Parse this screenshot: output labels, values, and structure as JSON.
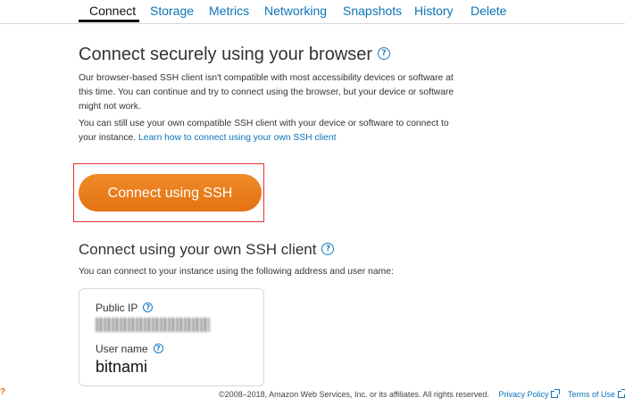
{
  "tabs": [
    {
      "label": "Connect",
      "active": true
    },
    {
      "label": "Storage"
    },
    {
      "label": "Metrics"
    },
    {
      "label": "Networking"
    },
    {
      "label": "Snapshots"
    },
    {
      "label": "History"
    },
    {
      "label": "Delete"
    }
  ],
  "browser_section": {
    "title": "Connect securely using your browser",
    "help_icon": "?",
    "para1": "Our browser-based SSH client isn't compatible with most accessibility devices or software at this time. You can continue and try to connect using the browser, but your device or software might not work.",
    "para2_text": "You can still use your own compatible SSH client with your device or software to connect to your instance.",
    "para2_link": "Learn how to connect using your own SSH client",
    "button_label": "Connect using SSH"
  },
  "own_client_section": {
    "title": "Connect using your own SSH client",
    "help_icon": "?",
    "description": "You can connect to your instance using the following address and user name:",
    "public_ip_label": "Public IP",
    "user_name_label": "User name",
    "user_name_value": "bitnami"
  },
  "footer": {
    "copyright": "©2008–2018, Amazon Web Services, Inc. or its affiliates. All rights reserved.",
    "privacy_link": "Privacy Policy",
    "terms_link": "Terms of Use"
  },
  "corner_mark": "?",
  "colors": {
    "link": "#0b74b8",
    "button": "#e37311",
    "highlight": "#e23535"
  }
}
